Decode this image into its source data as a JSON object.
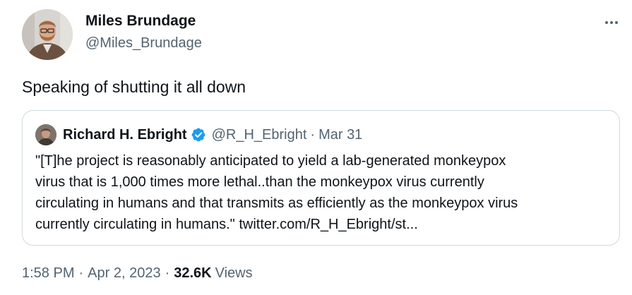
{
  "author": {
    "name": "Miles Brundage",
    "handle": "@Miles_Brundage"
  },
  "tweet": {
    "text": "Speaking of shutting it all down"
  },
  "quoted_tweet": {
    "name": "Richard H. Ebright",
    "verified": true,
    "handle": "@R_H_Ebright",
    "separator": "·",
    "date": "Mar 31",
    "text_lines": [
      "\"[T]he project is reasonably anticipated to yield a lab-generated monkeypox",
      "virus that is 1,000 times more lethal..than the monkeypox virus currently",
      "circulating in humans and that transmits as efficiently as the monkeypox virus",
      "currently circulating in humans.\" twitter.com/R_H_Ebright/st..."
    ]
  },
  "meta": {
    "time": "1:58 PM",
    "separator": "·",
    "date": "Apr 2, 2023",
    "views_count": "32.6K",
    "views_label": "Views"
  },
  "icons": {
    "more": "more-options-icon",
    "verified": "verified-badge-icon"
  },
  "colors": {
    "text_primary": "#0f1419",
    "text_secondary": "#536471",
    "border": "#cfd9de",
    "verified_blue": "#1d9bf0"
  }
}
